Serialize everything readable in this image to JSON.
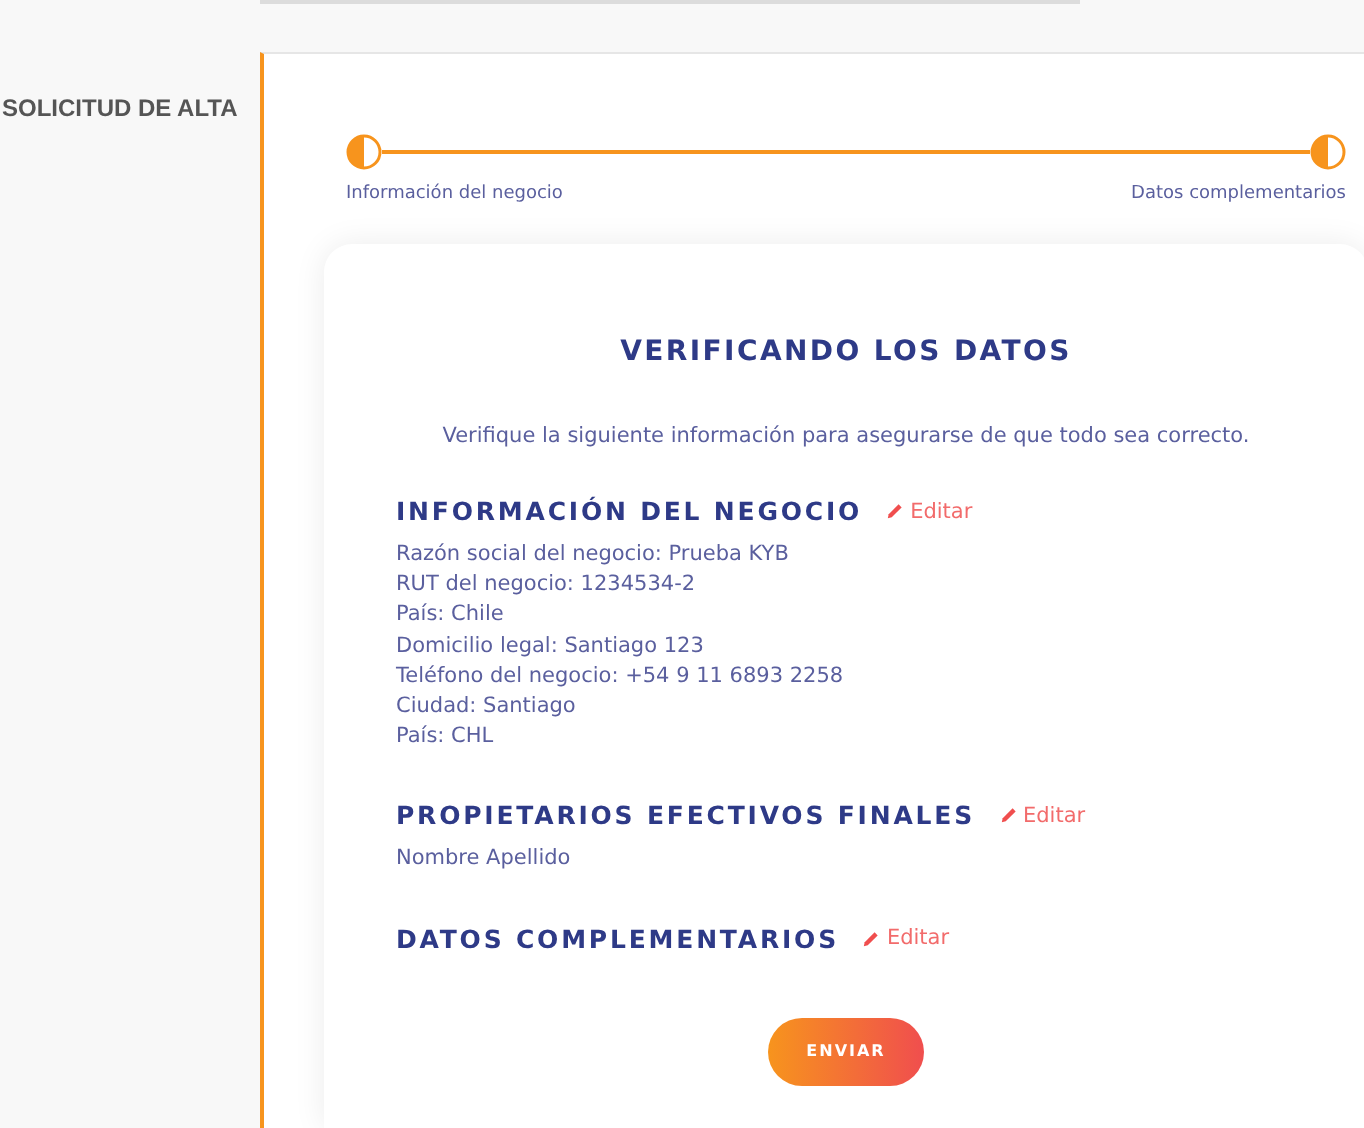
{
  "sidebar": {
    "title": "SOLICITUD DE ALTA"
  },
  "steps": [
    {
      "label": "Información del negocio"
    },
    {
      "label": "Datos complementarios"
    }
  ],
  "card": {
    "title": "VERIFICANDO LOS DATOS",
    "subtitle": "Verifique la siguiente información para asegurarse de que todo sea correcto.",
    "sections": [
      {
        "heading": "INFORMACIÓN DEL NEGOCIO",
        "edit": "Editar",
        "lines": [
          "Razón social del negocio: Prueba KYB",
          "RUT del negocio: 1234534-2",
          "País: Chile",
          "Domicilio legal: Santiago 123",
          "Teléfono del negocio: +54 9 11 6893 2258",
          "Ciudad: Santiago",
          "País: CHL"
        ]
      },
      {
        "heading": "PROPIETARIOS EFECTIVOS FINALES",
        "edit": "Editar",
        "lines": [
          "Nombre Apellido"
        ]
      },
      {
        "heading": "DATOS COMPLEMENTARIOS",
        "edit": "Editar"
      }
    ],
    "button": "ENVIAR"
  }
}
